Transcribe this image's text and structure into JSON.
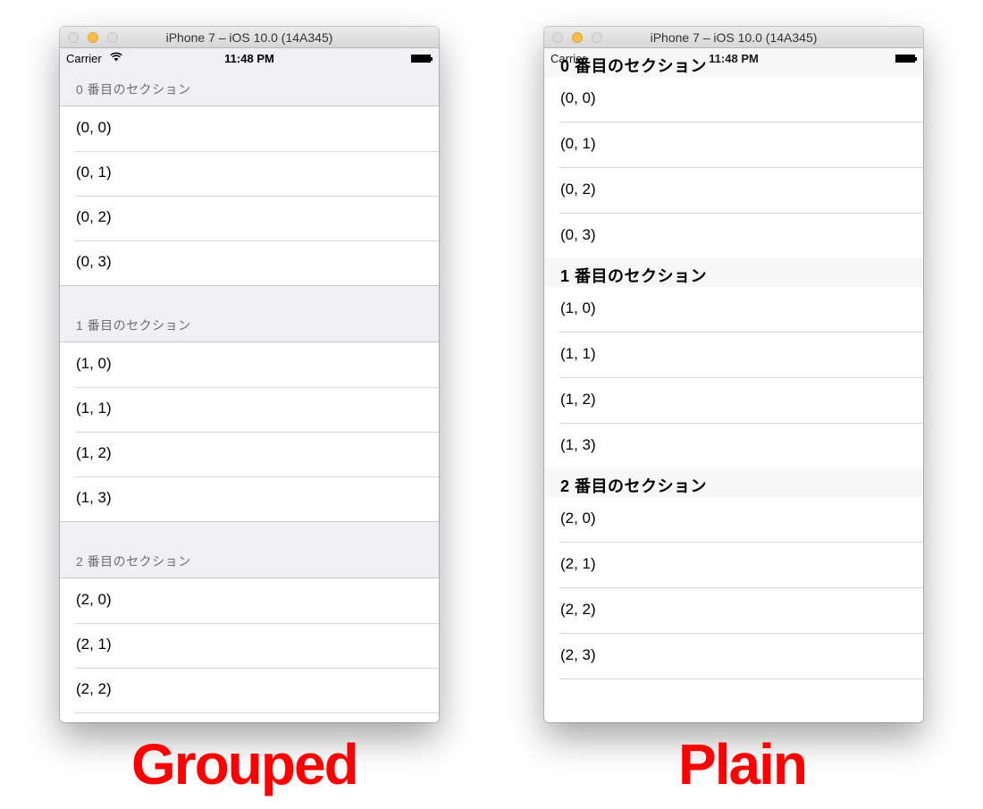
{
  "windows": {
    "grouped": {
      "title": "iPhone 7 – iOS 10.0 (14A345)",
      "carrier": "Carrier",
      "time": "11:48 PM",
      "sections": [
        {
          "header": "0 番目のセクション",
          "rows": [
            "(0, 0)",
            "(0, 1)",
            "(0, 2)",
            "(0, 3)"
          ]
        },
        {
          "header": "1 番目のセクション",
          "rows": [
            "(1, 0)",
            "(1, 1)",
            "(1, 2)",
            "(1, 3)"
          ]
        },
        {
          "header": "2 番目のセクション",
          "rows": [
            "(2, 0)",
            "(2, 1)",
            "(2, 2)"
          ]
        }
      ]
    },
    "plain": {
      "title": "iPhone 7 – iOS 10.0 (14A345)",
      "carrier": "Carrier",
      "time": "11:48 PM",
      "sections": [
        {
          "header": "0 番目のセクション",
          "rows": [
            "(0, 0)",
            "(0, 1)",
            "(0, 2)",
            "(0, 3)"
          ]
        },
        {
          "header": "1 番目のセクション",
          "rows": [
            "(1, 0)",
            "(1, 1)",
            "(1, 2)",
            "(1, 3)"
          ]
        },
        {
          "header": "2 番目のセクション",
          "rows": [
            "(2, 0)",
            "(2, 1)",
            "(2, 2)",
            "(2, 3)"
          ]
        }
      ]
    }
  },
  "captions": {
    "grouped": "Grouped",
    "plain": "Plain"
  },
  "colors": {
    "caption": "#ff0000",
    "grouped_background": "#efeff4",
    "separator": "#d8d8dc"
  },
  "icons": {
    "wifi": "wifi-icon",
    "battery": "battery-icon"
  }
}
